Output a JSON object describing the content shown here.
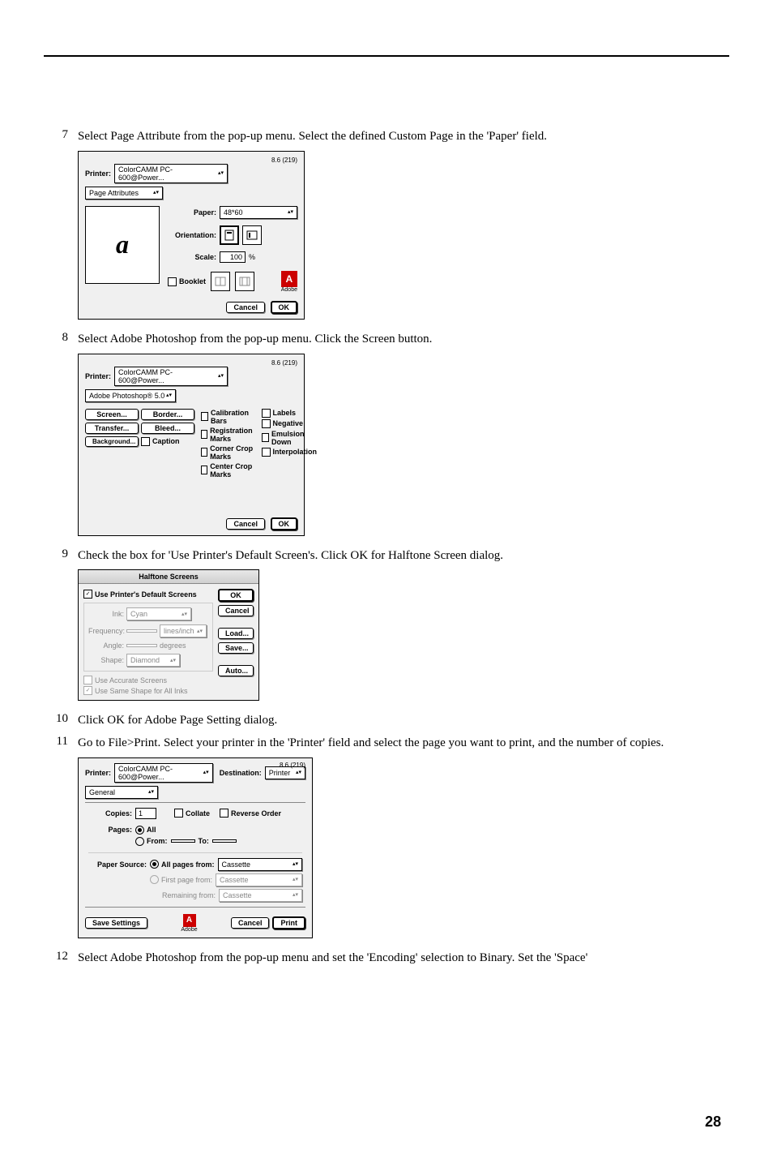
{
  "page_number": "28",
  "steps": {
    "s7": {
      "num": "7",
      "text": "Select Page Attribute from the pop-up menu. Select the defined Custom Page in the 'Paper' field."
    },
    "s8": {
      "num": "8",
      "text": "Select Adobe Photoshop from the pop-up menu. Click the Screen button."
    },
    "s9": {
      "num": "9",
      "text": "Check the box for 'Use Printer's Default Screen's. Click OK for Halftone Screen dialog."
    },
    "s10": {
      "num": "10",
      "text": "Click OK for Adobe Page Setting dialog."
    },
    "s11": {
      "num": "11",
      "text": "Go to File>Print. Select your printer in the 'Printer' field and select the page you want to print, and the number of copies."
    },
    "s12": {
      "num": "12",
      "text": "Select Adobe Photoshop from the pop-up menu and set the 'Encoding' selection to Binary. Set the 'Space'"
    }
  },
  "dlg1": {
    "version": "8.6 (219)",
    "printer_label": "Printer:",
    "printer_value": "ColorCAMM PC-600@Power...",
    "tab": "Page Attributes",
    "paper_label": "Paper:",
    "paper_value": "48*60",
    "orientation_label": "Orientation:",
    "scale_label": "Scale:",
    "scale_value": "100",
    "scale_unit": "%",
    "booklet": "Booklet",
    "adobe_caption": "Adobe",
    "cancel": "Cancel",
    "ok": "OK"
  },
  "dlg2": {
    "version": "8.6 (219)",
    "printer_label": "Printer:",
    "printer_value": "ColorCAMM PC-600@Power...",
    "tab": "Adobe Photoshop® 5.0",
    "btn_screen": "Screen...",
    "btn_border": "Border...",
    "btn_transfer": "Transfer...",
    "btn_bleed": "Bleed...",
    "btn_background": "Background...",
    "chk_caption": "Caption",
    "chk_cal_bars": "Calibration Bars",
    "chk_reg_marks": "Registration Marks",
    "chk_corner_crop": "Corner Crop Marks",
    "chk_center_crop": "Center Crop Marks",
    "chk_labels": "Labels",
    "chk_negative": "Negative",
    "chk_emulsion": "Emulsion Down",
    "chk_interpolation": "Interpolation",
    "cancel": "Cancel",
    "ok": "OK"
  },
  "dlg3": {
    "title": "Halftone Screens",
    "chk_use_default": "Use Printer's Default Screens",
    "ink_label": "Ink:",
    "ink_value": "Cyan",
    "freq_label": "Frequency:",
    "freq_unit": "lines/inch",
    "angle_label": "Angle:",
    "angle_unit": "degrees",
    "shape_label": "Shape:",
    "shape_value": "Diamond",
    "chk_accurate": "Use Accurate Screens",
    "chk_same_shape": "Use Same Shape for All Inks",
    "ok": "OK",
    "cancel": "Cancel",
    "load": "Load...",
    "save": "Save...",
    "auto": "Auto..."
  },
  "dlg4": {
    "version": "8.6 (219)",
    "printer_label": "Printer:",
    "printer_value": "ColorCAMM PC-600@Power...",
    "dest_label": "Destination:",
    "dest_value": "Printer",
    "tab": "General",
    "copies_label": "Copies:",
    "copies_value": "1",
    "chk_collate": "Collate",
    "chk_reverse": "Reverse Order",
    "pages_label": "Pages:",
    "radio_all": "All",
    "radio_from": "From:",
    "to_label": "To:",
    "paper_source_label": "Paper Source:",
    "radio_all_pages_from": "All pages from:",
    "radio_first_page_from": "First page from:",
    "remaining_from": "Remaining from:",
    "cassette": "Cassette",
    "save_settings": "Save Settings",
    "adobe_caption": "Adobe",
    "cancel": "Cancel",
    "print": "Print"
  }
}
